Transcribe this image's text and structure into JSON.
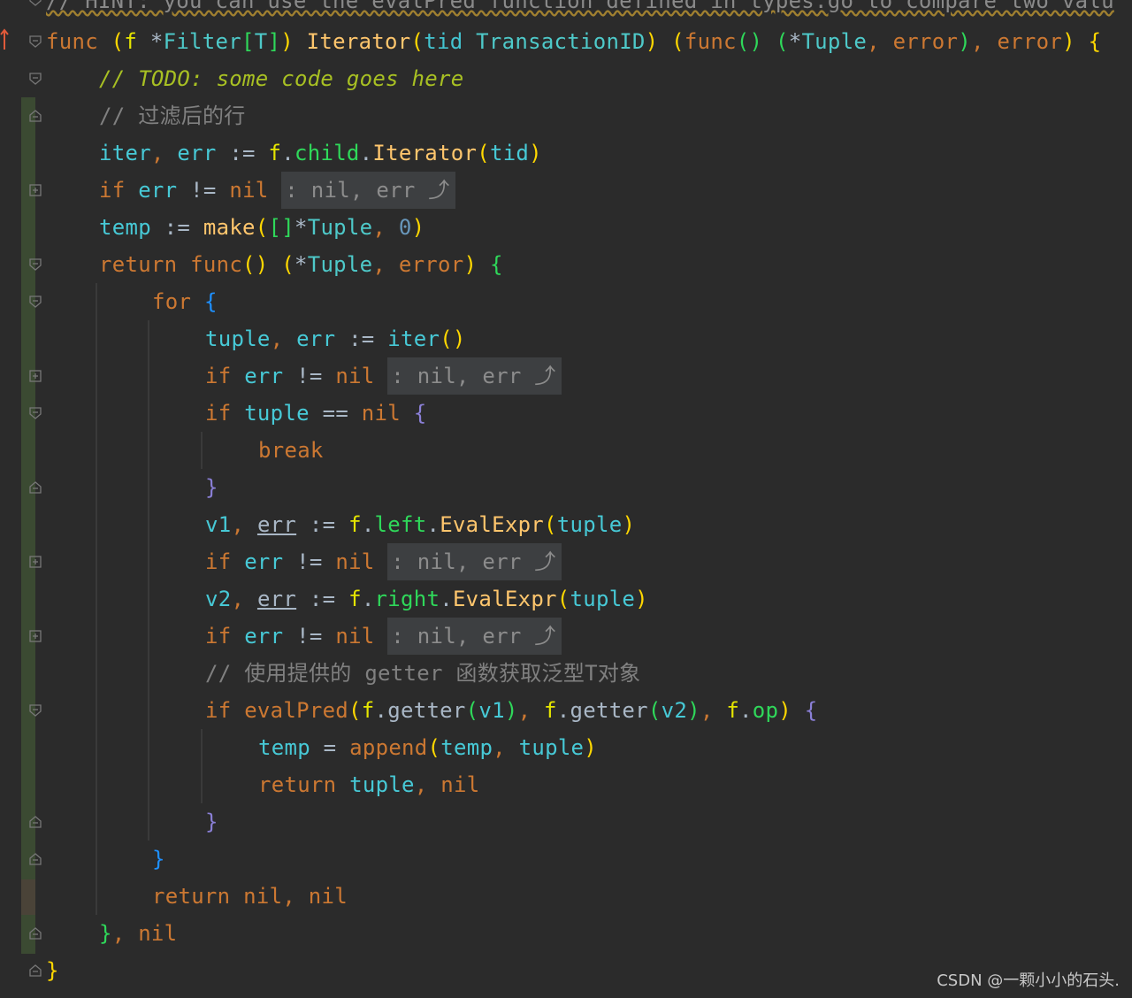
{
  "editor": {
    "language": "go",
    "colors": {
      "background": "#2b2b2b",
      "keyword": "#cc7832",
      "function": "#ffc66d",
      "comment": "#808080",
      "todo": "#a8c023",
      "fold_hint_bg": "#3d3f41"
    },
    "lines": [
      {
        "text": "// HINT: you can use the evalPred function defined in types.go to compare two value"
      },
      {
        "text": "func (f *Filter[T]) Iterator(tid TransactionID) (func() (*Tuple, error), error) {"
      },
      {
        "text": "// TODO: some code goes here"
      },
      {
        "text": "// 过滤后的行"
      },
      {
        "text": "iter, err := f.child.Iterator(tid)"
      },
      {
        "text": "if err != nil",
        "fold_hint": ": nil, err ⤴"
      },
      {
        "text": "temp := make([]*Tuple, 0)"
      },
      {
        "text": "return func() (*Tuple, error) {"
      },
      {
        "text": "for {"
      },
      {
        "text": "tuple, err := iter()"
      },
      {
        "text": "if err != nil",
        "fold_hint": ": nil, err ⤴"
      },
      {
        "text": "if tuple == nil {"
      },
      {
        "text": "break"
      },
      {
        "text": "}"
      },
      {
        "text": "v1, err := f.left.EvalExpr(tuple)"
      },
      {
        "text": "if err != nil",
        "fold_hint": ": nil, err ⤴"
      },
      {
        "text": "v2, err := f.right.EvalExpr(tuple)"
      },
      {
        "text": "if err != nil",
        "fold_hint": ": nil, err ⤴"
      },
      {
        "text": "// 使用提供的 getter 函数获取泛型T对象"
      },
      {
        "text": "if evalPred(f.getter(v1), f.getter(v2), f.op) {"
      },
      {
        "text": "temp = append(temp, tuple)"
      },
      {
        "text": "return tuple, nil"
      },
      {
        "text": "}"
      },
      {
        "text": "}"
      },
      {
        "text": "return nil, nil"
      },
      {
        "text": "}, nil"
      },
      {
        "text": "}"
      }
    ],
    "tokens": {
      "hint": "// HINT: you can use the evalPred function defined in types.go to compare two valu",
      "func": "func",
      "f": "f",
      "star": "*",
      "Filter": "Filter",
      "T": "T",
      "Iterator": "Iterator",
      "tid": "tid",
      "TransactionID": "TransactionID",
      "Tuple": "Tuple",
      "error": "error",
      "todo": "// TODO: some code goes here",
      "cm_filtered": "// 过滤后的行",
      "iter": "iter",
      "err": "err",
      "assign": ":=",
      "child": "child",
      "if": "if",
      "neq": "!=",
      "eq": "==",
      "nil": "nil",
      "fold_hint": ": nil, err ⤴",
      "temp": "temp",
      "make": "make",
      "zero": "0",
      "return": "return",
      "for": "for",
      "tuple": "tuple",
      "break": "break",
      "v1": "v1",
      "v2": "v2",
      "left": "left",
      "right": "right",
      "EvalExpr": "EvalExpr",
      "cm_getter": "// 使用提供的 getter 函数获取泛型T对象",
      "evalPred": "evalPred",
      "getter": "getter",
      "op": "op",
      "append": "append",
      "equals": "="
    }
  },
  "watermark": "CSDN @一颗小小的石头."
}
